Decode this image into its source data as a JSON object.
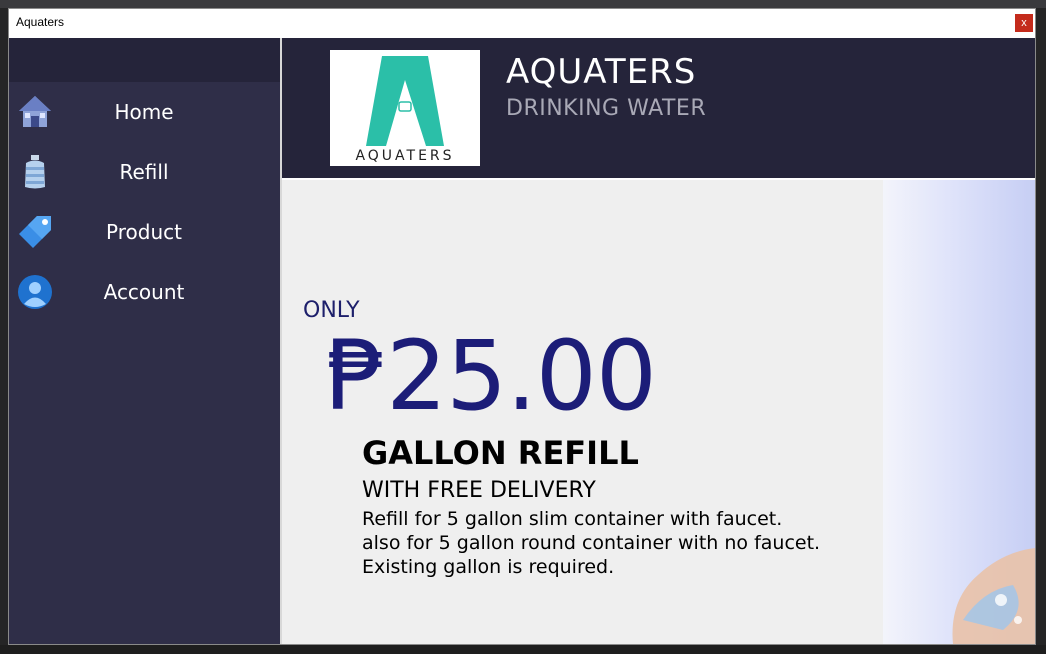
{
  "window": {
    "title": "Aquaters",
    "close_label": "x"
  },
  "sidebar": {
    "items": [
      {
        "label": "Home",
        "icon": "house-icon"
      },
      {
        "label": "Refill",
        "icon": "water-bottle-icon"
      },
      {
        "label": "Product",
        "icon": "tag-icon"
      },
      {
        "label": "Account",
        "icon": "user-icon"
      }
    ]
  },
  "header": {
    "logo_text": "AQUATERS",
    "brand_title": "AQUATERS",
    "brand_subtitle": "DRINKING WATER"
  },
  "promo": {
    "only": "ONLY",
    "price": "₱25.00",
    "headline": "GALLON REFILL",
    "delivery": "WITH FREE DELIVERY",
    "lines": [
      "Refill for 5 gallon slim container with faucet.",
      "also for 5 gallon round container with no faucet.",
      "Existing gallon is required."
    ]
  },
  "colors": {
    "sidebar_bg": "#2f2e48",
    "header_bg": "#25243a",
    "price_color": "#1c1d78",
    "logo_teal": "#2bbfa8"
  }
}
